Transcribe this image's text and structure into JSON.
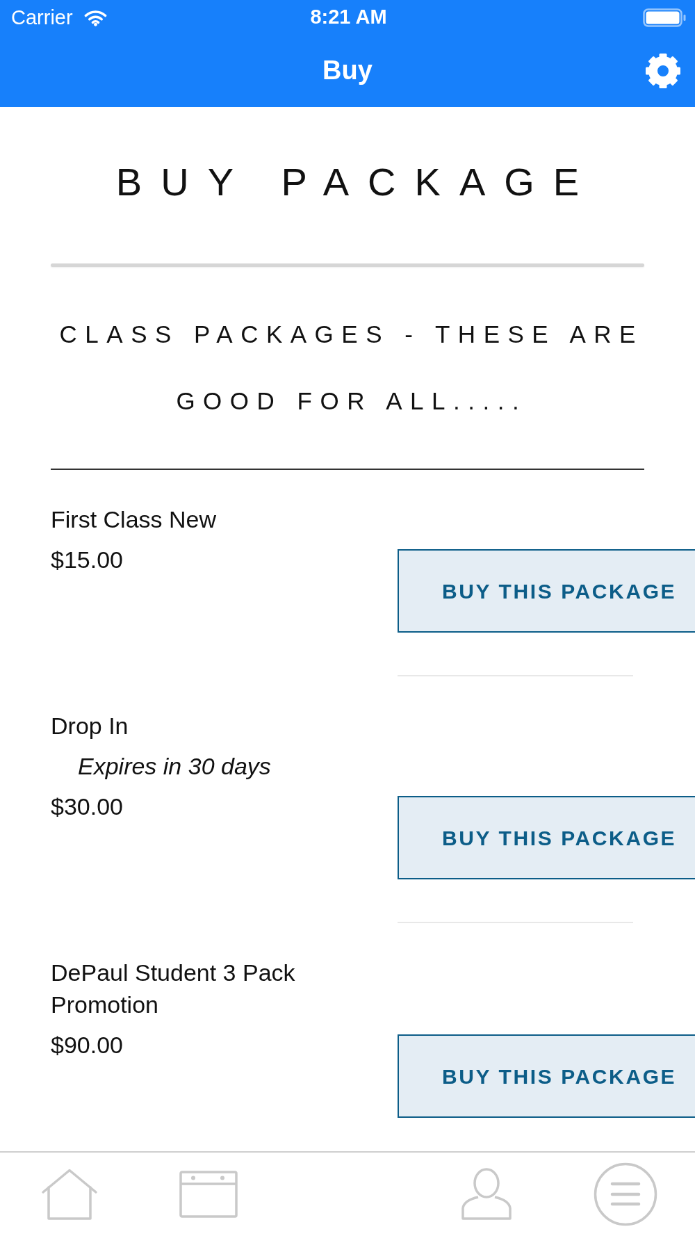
{
  "status_bar": {
    "carrier": "Carrier",
    "time": "8:21 AM"
  },
  "nav_bar": {
    "title": "Buy"
  },
  "heading": "BUY PACKAGE",
  "section_title": "CLASS PACKAGES - THESE ARE GOOD FOR ALL.....",
  "packages": [
    {
      "name": "First Class New",
      "price": "$15.00",
      "button": "BUY THIS PACKAGE"
    },
    {
      "name": "Drop In",
      "expiry": "Expires in 30 days",
      "price": "$30.00",
      "button": "BUY THIS PACKAGE"
    },
    {
      "name": "DePaul Student 3 Pack Promotion",
      "price": "$90.00",
      "button": "BUY THIS PACKAGE"
    }
  ],
  "tab_bar": [
    {
      "kind": "home",
      "selected": false
    },
    {
      "kind": "calendar",
      "selected": false
    },
    {
      "kind": "profile",
      "selected": false
    },
    {
      "kind": "menu",
      "selected": false
    }
  ]
}
